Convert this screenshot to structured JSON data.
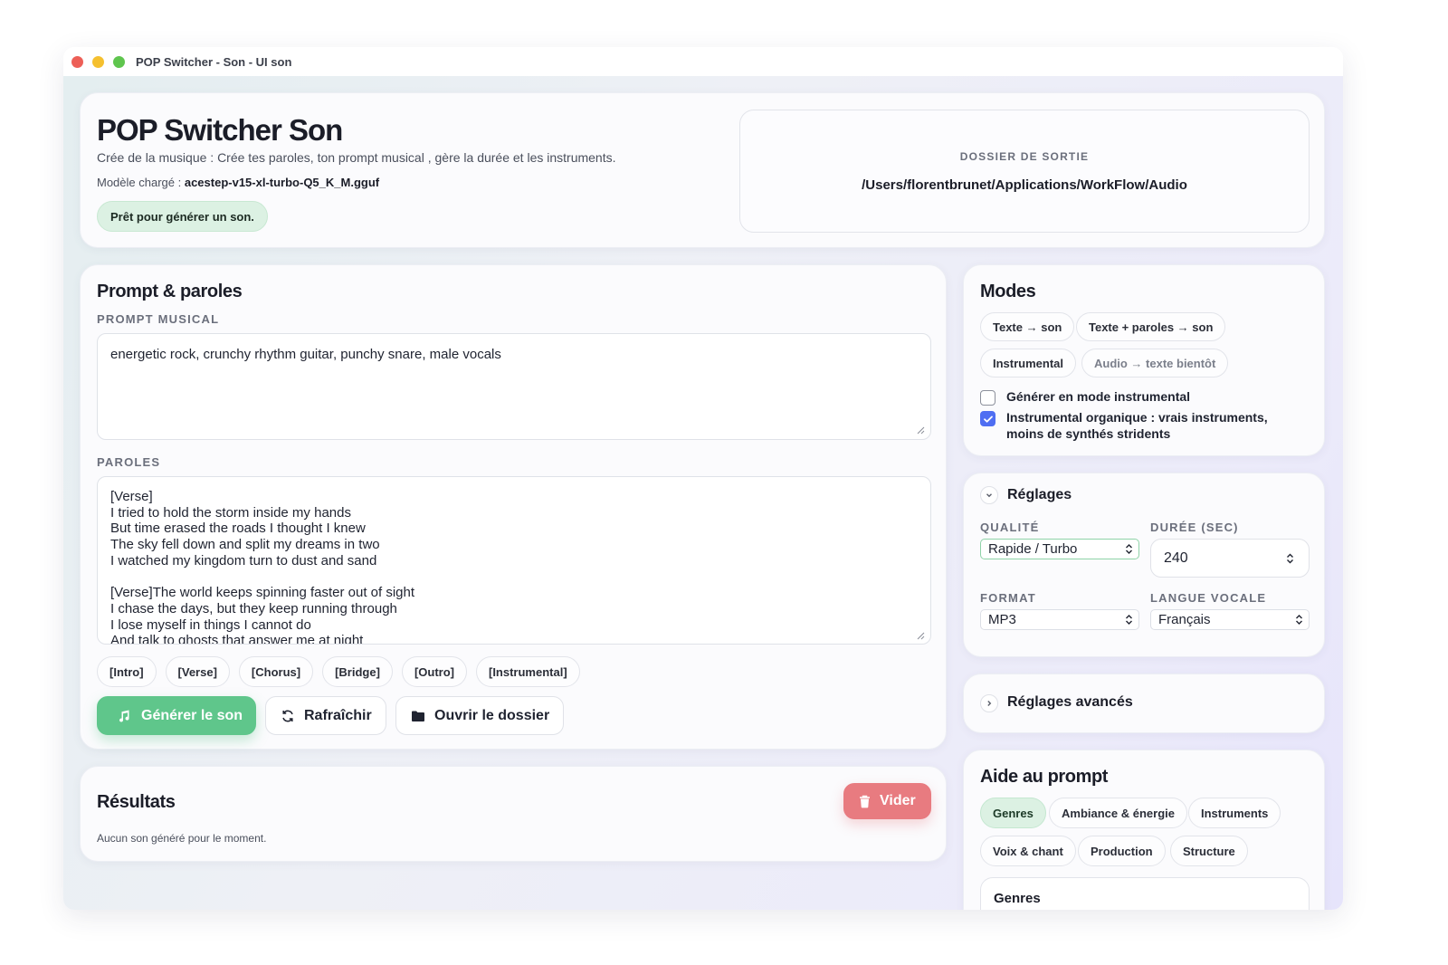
{
  "window": {
    "title": "POP Switcher - Son - UI son"
  },
  "header": {
    "title": "POP Switcher Son",
    "subtitle": "Crée de la musique : Crée tes paroles, ton prompt musical , gère la durée et les instruments.",
    "model_label": "Modèle chargé : ",
    "model_value": "acestep-v15-xl-turbo-Q5_K_M.gguf",
    "status": "Prêt pour générer un son.",
    "output_label": "DOSSIER DE SORTIE",
    "output_path": "/Users/florentbrunet/Applications/WorkFlow/Audio"
  },
  "prompt_card": {
    "title": "Prompt & paroles",
    "prompt_label": "PROMPT MUSICAL",
    "prompt_value": "energetic rock, crunchy rhythm guitar, punchy snare, male vocals",
    "lyrics_label": "PAROLES",
    "lyrics_lines": [
      "[Verse]",
      "I tried to hold the storm inside my hands",
      "But time erased the roads I thought I knew",
      "The sky fell down and split my dreams in two",
      "I watched my kingdom turn to dust and sand",
      "",
      "[Verse]The world keeps spinning faster out of sight",
      "I chase the days, but they keep running through",
      "I lose myself in things I cannot do",
      "And talk to ghosts that answer me at night"
    ],
    "tags": [
      "[Intro]",
      "[Verse]",
      "[Chorus]",
      "[Bridge]",
      "[Outro]",
      "[Instrumental]"
    ],
    "generate_label": "Générer le son",
    "refresh_label": "Rafraîchir",
    "open_folder_label": "Ouvrir le dossier"
  },
  "results": {
    "title": "Résultats",
    "clear_label": "Vider",
    "empty_text": "Aucun son généré pour le moment."
  },
  "modes": {
    "title": "Modes",
    "pills": [
      "Texte → son",
      "Texte + paroles → son",
      "Instrumental",
      "Audio → texte bientôt"
    ],
    "option_instrumental": "Générer en mode instrumental",
    "option_organic_line1": "Instrumental organique : vrais instruments,",
    "option_organic_line2": "moins de synthés stridents",
    "option_instrumental_checked": false,
    "option_organic_checked": true
  },
  "settings": {
    "title": "Réglages",
    "quality_label": "QUALITÉ",
    "quality_value": "Rapide / Turbo",
    "duration_label": "DURÉE (SEC)",
    "duration_value": "240",
    "format_label": "FORMAT",
    "format_value": "MP3",
    "voice_label": "LANGUE VOCALE",
    "voice_value": "Français"
  },
  "advanced": {
    "title": "Réglages avancés"
  },
  "prompt_help": {
    "title": "Aide au prompt",
    "tabs": [
      "Genres",
      "Ambiance & énergie",
      "Instruments",
      "Voix & chant",
      "Production",
      "Structure"
    ],
    "section_title": "Genres"
  },
  "colors": {
    "accent_green": "#5cc488",
    "accent_red": "#e87b80",
    "accent_blue": "#4f6ef2"
  }
}
